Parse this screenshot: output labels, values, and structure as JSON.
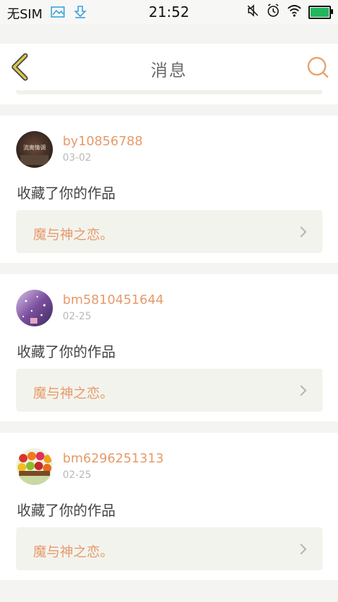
{
  "status_bar": {
    "carrier": "无SIM",
    "time": "21:52",
    "icons": [
      "image-icon",
      "download-icon",
      "mute-icon",
      "alarm-icon",
      "wifi-icon",
      "battery-icon"
    ],
    "accent_color": "#3aa0e0",
    "battery_color": "#20b85b"
  },
  "header": {
    "title": "消息",
    "back_icon": "chevron-left-icon",
    "search_icon": "search-icon",
    "accent_color": "#e8a46f",
    "back_color": "#d8c64a"
  },
  "messages": [
    {
      "username": "by10856788",
      "date": "03-02",
      "action": "收藏了你的作品",
      "work_title": "魔与神之恋。",
      "avatar_text": "流离情调"
    },
    {
      "username": "bm5810451644",
      "date": "02-25",
      "action": "收藏了你的作品",
      "work_title": "魔与神之恋。"
    },
    {
      "username": "bm6296251313",
      "date": "02-25",
      "action": "收藏了你的作品",
      "work_title": "魔与神之恋。"
    }
  ]
}
